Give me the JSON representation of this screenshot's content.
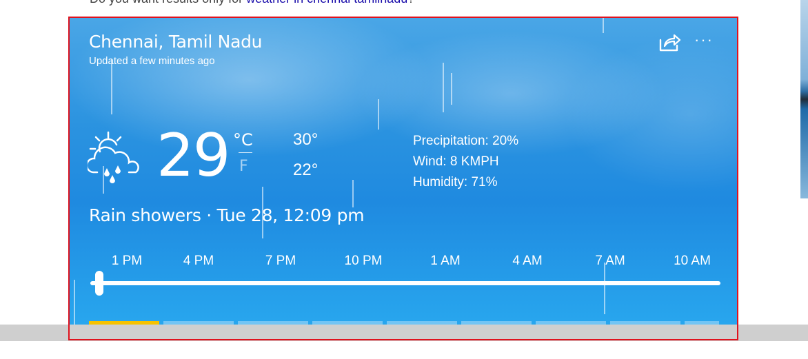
{
  "search_hint": {
    "prefix": "Do you want results only for ",
    "link": "weather in chennai tamilnadu",
    "suffix": "?"
  },
  "weather": {
    "location": "Chennai, Tamil Nadu",
    "updated": "Updated a few minutes ago",
    "icons": {
      "share": "share-icon",
      "more": "more-options-icon",
      "condition": "cloud-sun-rain-icon"
    },
    "more_label": "···",
    "temperature": "29",
    "unit_c": "°C",
    "unit_f": "F",
    "high": "30°",
    "low": "22°",
    "precipitation": "Precipitation: 20%",
    "wind": "Wind: 8 KMPH",
    "humidity": "Humidity: 71%",
    "condition": "Rain showers · Tue 28, 12:09 pm",
    "hours": [
      "1 PM",
      "4 PM",
      "7 PM",
      "10 PM",
      "1 AM",
      "4 AM",
      "7 AM",
      "10 AM"
    ],
    "slider_value": 0,
    "active_tab": 0,
    "tab_count": 9
  },
  "colors": {
    "accent_tab": "#f6c200",
    "card_blue": "#2b93e0",
    "outline_red": "#e0121d",
    "link_blue": "#1a0dab"
  }
}
